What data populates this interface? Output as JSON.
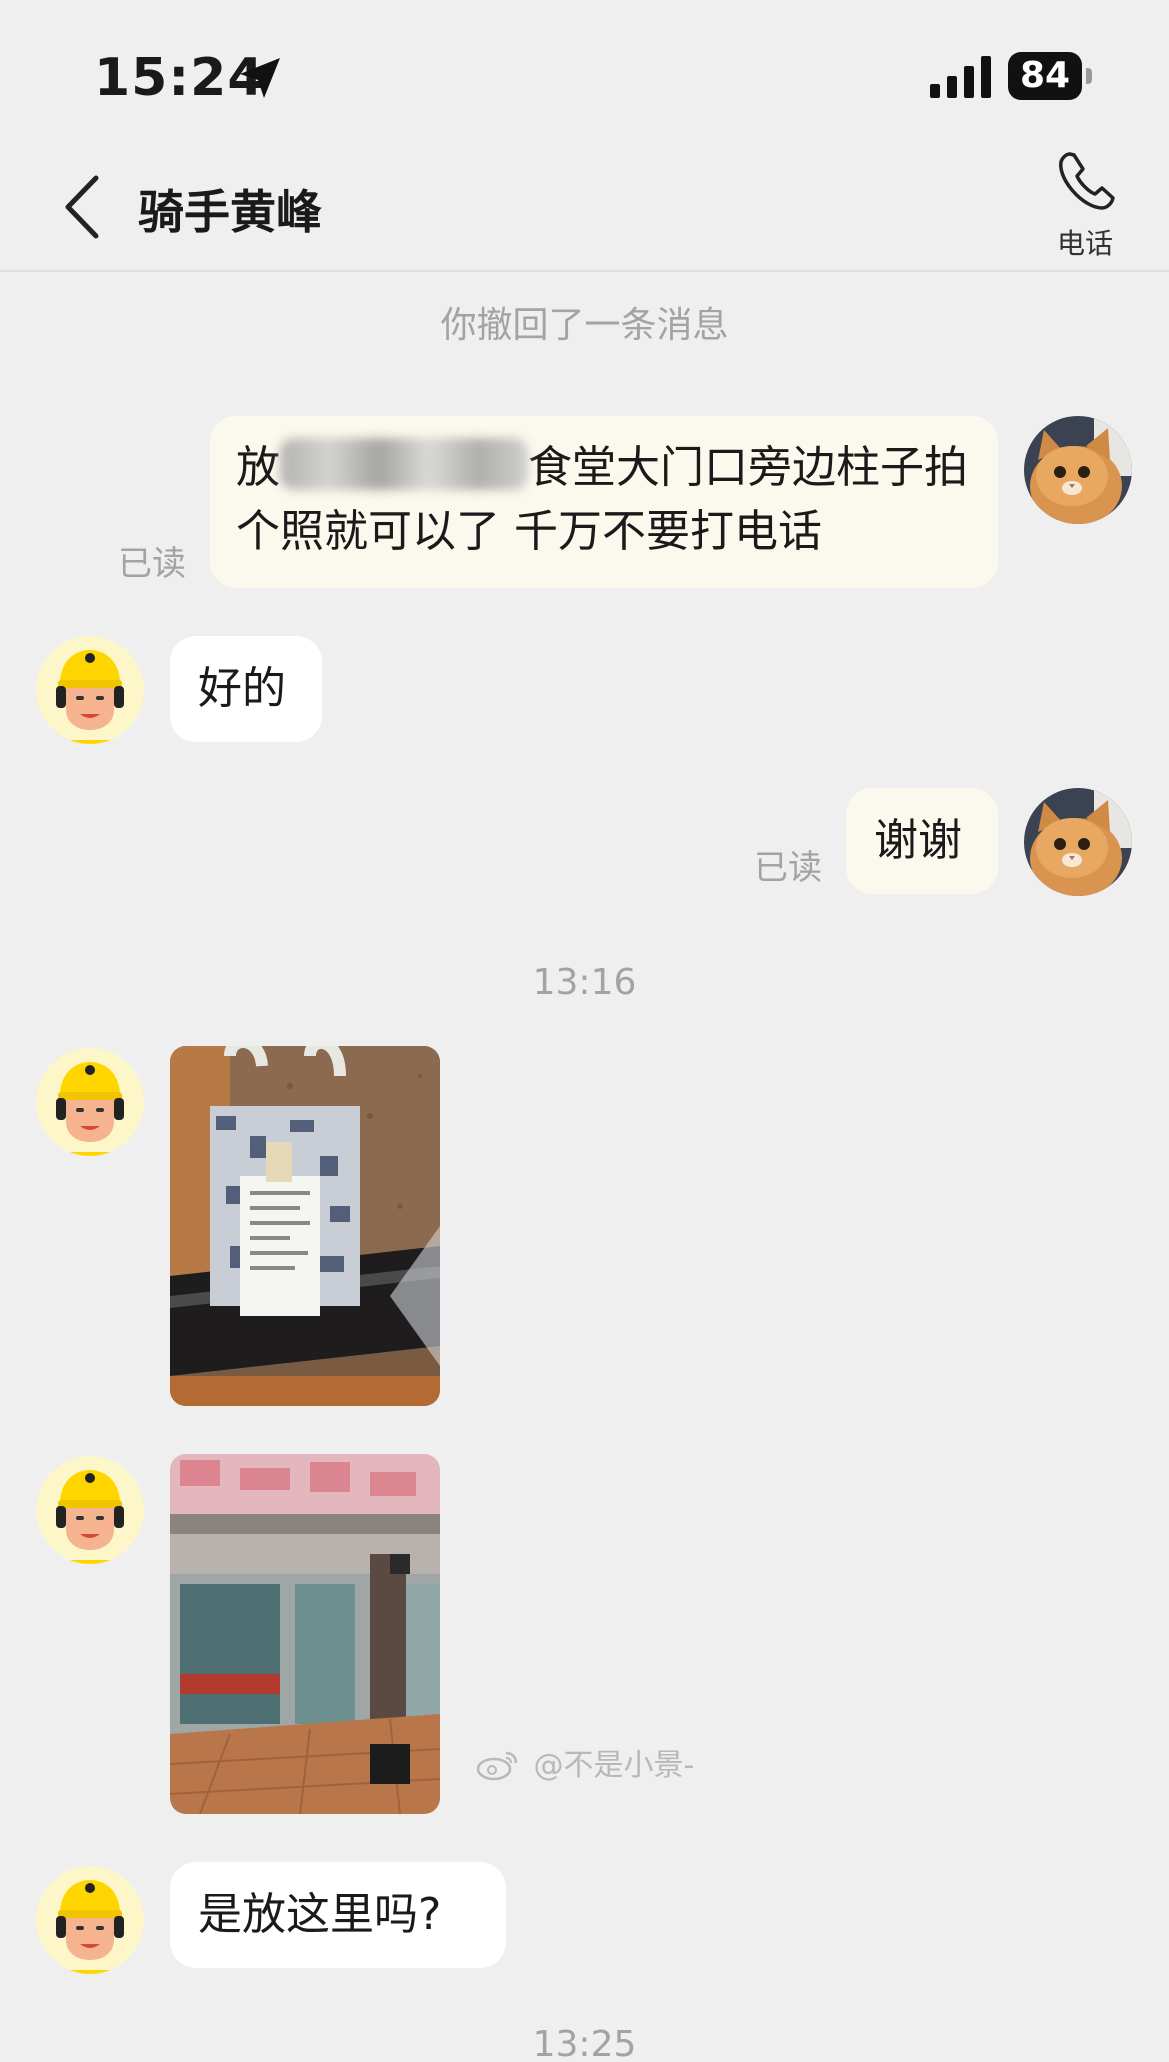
{
  "status_bar": {
    "time": "15:24",
    "battery": "84"
  },
  "header": {
    "title": "骑手黄峰",
    "phone_label": "电话"
  },
  "messages": {
    "recall_notice": "你撤回了一条消息",
    "m1": {
      "before": "放",
      "after": "食堂大门口旁边柱子拍",
      "line2": "个照就可以了  千万不要打电话",
      "read": "已读"
    },
    "m2": "好的",
    "m3": {
      "text": "谢谢",
      "read": "已读"
    },
    "time1": "13:16",
    "m6": "是放这里吗?",
    "time2": "13:25"
  },
  "watermark": "@不是小景-",
  "colors": {
    "background": "#efefef",
    "outgoing_bubble": "#fbf8ee",
    "incoming_bubble": "#ffffff",
    "rider_yellow": "#ffd500"
  }
}
